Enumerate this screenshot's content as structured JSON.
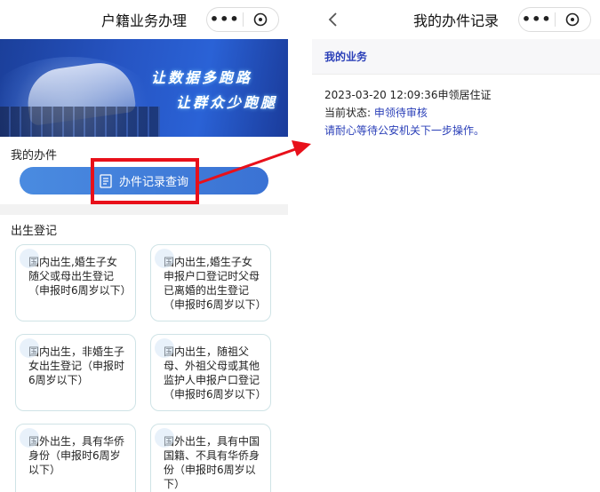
{
  "left_screen": {
    "title": "户籍业务办理",
    "more_icon": "more-dots-icon",
    "close_icon": "close-circle-icon",
    "banner": {
      "line1": "让数据多跑路",
      "line2": "让群众少跑腿"
    },
    "my_jobs_label": "我的办件",
    "record_button_label": "办件记录查询",
    "birth_section_label": "出生登记",
    "cards": [
      {
        "text": "国内出生,婚生子女随父或母出生登记（申报时6周岁以下）"
      },
      {
        "text": "国内出生,婚生子女申报户口登记时父母已离婚的出生登记（申报时6周岁以下）"
      },
      {
        "text": "国内出生，非婚生子女出生登记（申报时6周岁以下）"
      },
      {
        "text": "国内出生，随祖父母、外祖父母或其他监护人申报户口登记（申报时6周岁以下）"
      },
      {
        "text": "国外出生，具有华侨身份（申报时6周岁以下）"
      },
      {
        "text": "国外出生，具有中国国籍、不具有华侨身份（申报时6周岁以下）"
      }
    ]
  },
  "right_screen": {
    "title": "我的办件记录",
    "back_icon": "chevron-left-icon",
    "section_label": "我的业务",
    "record": {
      "datetime_and_type": "2023-03-20 12:09:36申领居住证",
      "status_label": "当前状态:",
      "status_value": "申领待审核",
      "hint": "请耐心等待公安机关下一步操作。"
    }
  },
  "colors": {
    "highlight_red": "#e8101a",
    "button_blue": "#3a72d4",
    "link_blue": "#2a3fb8"
  }
}
